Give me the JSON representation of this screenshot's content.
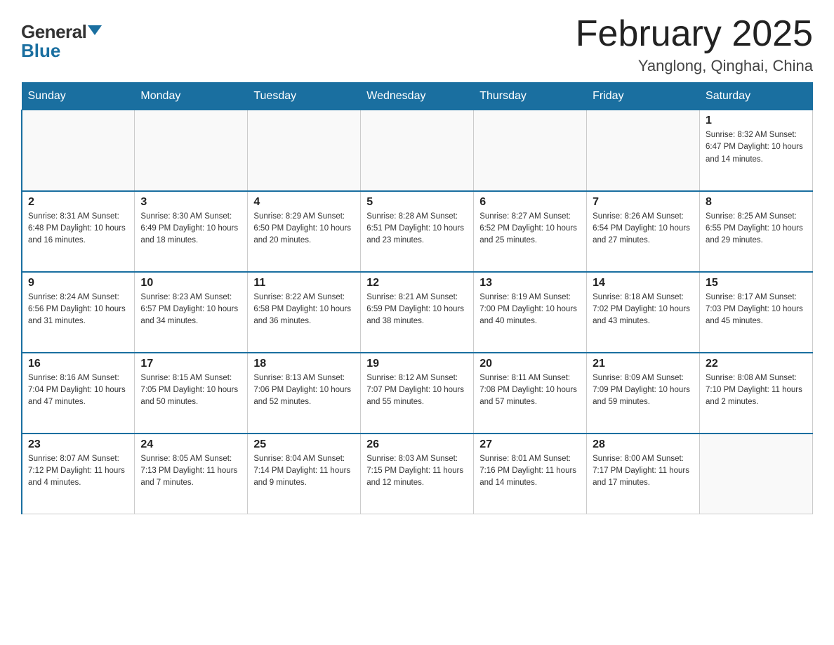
{
  "header": {
    "logo_general": "General",
    "logo_blue": "Blue",
    "month_title": "February 2025",
    "location": "Yanglong, Qinghai, China"
  },
  "weekdays": [
    "Sunday",
    "Monday",
    "Tuesday",
    "Wednesday",
    "Thursday",
    "Friday",
    "Saturday"
  ],
  "weeks": [
    [
      {
        "day": "",
        "info": ""
      },
      {
        "day": "",
        "info": ""
      },
      {
        "day": "",
        "info": ""
      },
      {
        "day": "",
        "info": ""
      },
      {
        "day": "",
        "info": ""
      },
      {
        "day": "",
        "info": ""
      },
      {
        "day": "1",
        "info": "Sunrise: 8:32 AM\nSunset: 6:47 PM\nDaylight: 10 hours and 14 minutes."
      }
    ],
    [
      {
        "day": "2",
        "info": "Sunrise: 8:31 AM\nSunset: 6:48 PM\nDaylight: 10 hours and 16 minutes."
      },
      {
        "day": "3",
        "info": "Sunrise: 8:30 AM\nSunset: 6:49 PM\nDaylight: 10 hours and 18 minutes."
      },
      {
        "day": "4",
        "info": "Sunrise: 8:29 AM\nSunset: 6:50 PM\nDaylight: 10 hours and 20 minutes."
      },
      {
        "day": "5",
        "info": "Sunrise: 8:28 AM\nSunset: 6:51 PM\nDaylight: 10 hours and 23 minutes."
      },
      {
        "day": "6",
        "info": "Sunrise: 8:27 AM\nSunset: 6:52 PM\nDaylight: 10 hours and 25 minutes."
      },
      {
        "day": "7",
        "info": "Sunrise: 8:26 AM\nSunset: 6:54 PM\nDaylight: 10 hours and 27 minutes."
      },
      {
        "day": "8",
        "info": "Sunrise: 8:25 AM\nSunset: 6:55 PM\nDaylight: 10 hours and 29 minutes."
      }
    ],
    [
      {
        "day": "9",
        "info": "Sunrise: 8:24 AM\nSunset: 6:56 PM\nDaylight: 10 hours and 31 minutes."
      },
      {
        "day": "10",
        "info": "Sunrise: 8:23 AM\nSunset: 6:57 PM\nDaylight: 10 hours and 34 minutes."
      },
      {
        "day": "11",
        "info": "Sunrise: 8:22 AM\nSunset: 6:58 PM\nDaylight: 10 hours and 36 minutes."
      },
      {
        "day": "12",
        "info": "Sunrise: 8:21 AM\nSunset: 6:59 PM\nDaylight: 10 hours and 38 minutes."
      },
      {
        "day": "13",
        "info": "Sunrise: 8:19 AM\nSunset: 7:00 PM\nDaylight: 10 hours and 40 minutes."
      },
      {
        "day": "14",
        "info": "Sunrise: 8:18 AM\nSunset: 7:02 PM\nDaylight: 10 hours and 43 minutes."
      },
      {
        "day": "15",
        "info": "Sunrise: 8:17 AM\nSunset: 7:03 PM\nDaylight: 10 hours and 45 minutes."
      }
    ],
    [
      {
        "day": "16",
        "info": "Sunrise: 8:16 AM\nSunset: 7:04 PM\nDaylight: 10 hours and 47 minutes."
      },
      {
        "day": "17",
        "info": "Sunrise: 8:15 AM\nSunset: 7:05 PM\nDaylight: 10 hours and 50 minutes."
      },
      {
        "day": "18",
        "info": "Sunrise: 8:13 AM\nSunset: 7:06 PM\nDaylight: 10 hours and 52 minutes."
      },
      {
        "day": "19",
        "info": "Sunrise: 8:12 AM\nSunset: 7:07 PM\nDaylight: 10 hours and 55 minutes."
      },
      {
        "day": "20",
        "info": "Sunrise: 8:11 AM\nSunset: 7:08 PM\nDaylight: 10 hours and 57 minutes."
      },
      {
        "day": "21",
        "info": "Sunrise: 8:09 AM\nSunset: 7:09 PM\nDaylight: 10 hours and 59 minutes."
      },
      {
        "day": "22",
        "info": "Sunrise: 8:08 AM\nSunset: 7:10 PM\nDaylight: 11 hours and 2 minutes."
      }
    ],
    [
      {
        "day": "23",
        "info": "Sunrise: 8:07 AM\nSunset: 7:12 PM\nDaylight: 11 hours and 4 minutes."
      },
      {
        "day": "24",
        "info": "Sunrise: 8:05 AM\nSunset: 7:13 PM\nDaylight: 11 hours and 7 minutes."
      },
      {
        "day": "25",
        "info": "Sunrise: 8:04 AM\nSunset: 7:14 PM\nDaylight: 11 hours and 9 minutes."
      },
      {
        "day": "26",
        "info": "Sunrise: 8:03 AM\nSunset: 7:15 PM\nDaylight: 11 hours and 12 minutes."
      },
      {
        "day": "27",
        "info": "Sunrise: 8:01 AM\nSunset: 7:16 PM\nDaylight: 11 hours and 14 minutes."
      },
      {
        "day": "28",
        "info": "Sunrise: 8:00 AM\nSunset: 7:17 PM\nDaylight: 11 hours and 17 minutes."
      },
      {
        "day": "",
        "info": ""
      }
    ]
  ]
}
